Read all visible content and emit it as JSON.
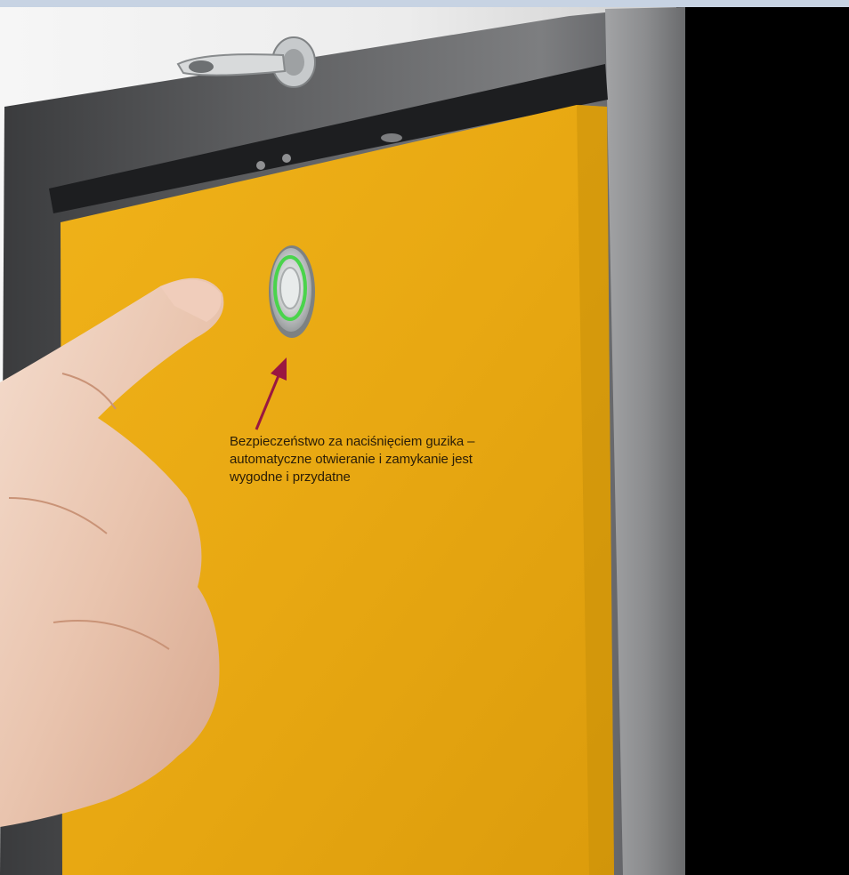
{
  "caption": {
    "line1": "Bezpieczeństwo za naciśnięciem guzika –",
    "line2": "automatyczne otwieranie i zamykanie jest",
    "line3": "wygodne i przydatne"
  },
  "colors": {
    "door_yellow": "#e9a912",
    "frame_grey": "#8c8d8f",
    "frame_dark": "#3c3d3f",
    "background_black": "#000000",
    "wall_white": "#f3f3f3",
    "arrow_crimson": "#9a1741",
    "button_led_green": "#4ad44c"
  },
  "icons": [
    "key-in-lock",
    "push-button",
    "pointing-hand",
    "annotation-arrow"
  ]
}
